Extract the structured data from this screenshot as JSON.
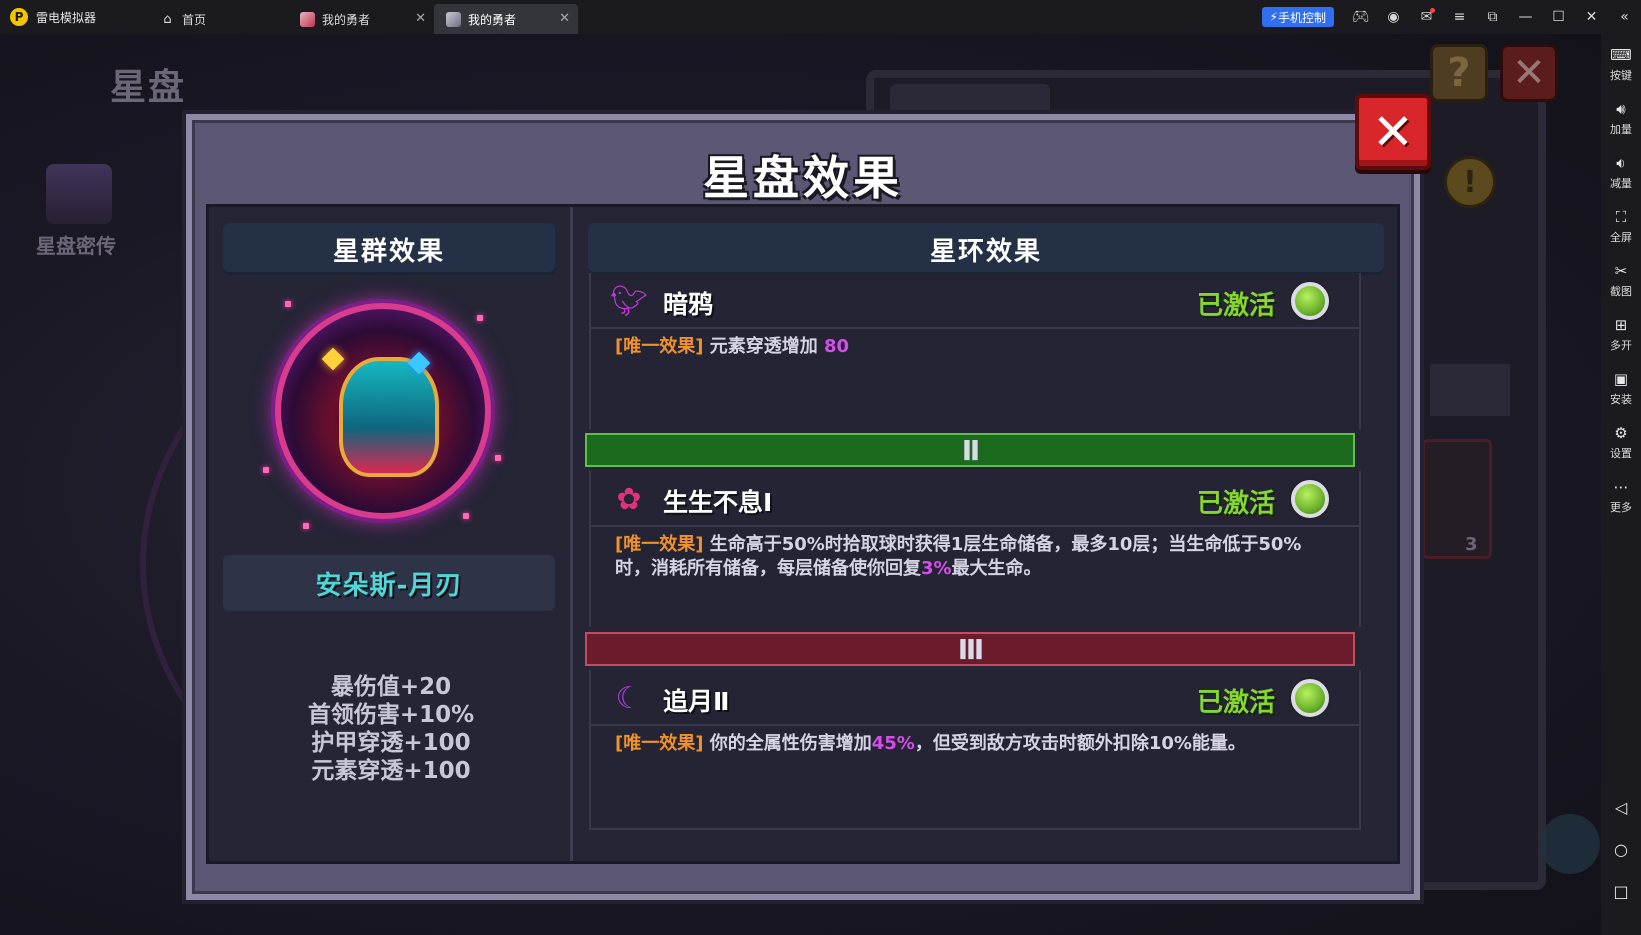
{
  "titlebar": {
    "app_name": "雷电模拟器",
    "tabs": [
      {
        "label": "首页"
      },
      {
        "label": "我的勇者"
      },
      {
        "label": "我的勇者"
      }
    ],
    "phone_control": "手机控制"
  },
  "sidebar": {
    "items": [
      {
        "label": "按键",
        "icon": "keyboard-icon"
      },
      {
        "label": "加量",
        "icon": "volume-up-icon"
      },
      {
        "label": "减量",
        "icon": "volume-down-icon"
      },
      {
        "label": "全屏",
        "icon": "fullscreen-icon"
      },
      {
        "label": "截图",
        "icon": "scissors-icon"
      },
      {
        "label": "多开",
        "icon": "multi-instance-icon"
      },
      {
        "label": "安装",
        "icon": "apk-install-icon"
      },
      {
        "label": "设置",
        "icon": "settings-icon"
      },
      {
        "label": "更多",
        "icon": "more-icon"
      }
    ]
  },
  "background": {
    "title": "星盘",
    "chest_label": "星盘密传",
    "slot_count": "3"
  },
  "dialog": {
    "title": "星盘效果",
    "left": {
      "header": "星群效果",
      "hero_name": "安朵斯-月刃",
      "stats": [
        "暴伤值+20",
        "首领伤害+10%",
        "护甲穿透+100",
        "元素穿透+100"
      ]
    },
    "right": {
      "header": "星环效果",
      "tiers": [
        {
          "label": "Ⅱ",
          "color": "#1c6a1e"
        },
        {
          "label": "Ⅲ",
          "color": "#6a1b2c"
        }
      ],
      "sections": [
        {
          "name": "暗鸦",
          "icon": "crow-icon",
          "status": "已激活",
          "tag": "[唯一效果]",
          "text_parts": [
            " 元素穿透增加 ",
            "80",
            "",
            "",
            ""
          ]
        },
        {
          "name": "生生不息Ⅰ",
          "icon": "flower-icon",
          "status": "已激活",
          "tag": "[唯一效果]",
          "text_parts": [
            " 生命高于50%时拾取球时获得1层生命储备，最多10层；当生命低于50%时，消耗所有储备，每层储备使你回复",
            "3%",
            "最大生命。",
            "",
            ""
          ]
        },
        {
          "name": "追月Ⅱ",
          "icon": "crescent-moon-icon",
          "status": "已激活",
          "tag": "[唯一效果]",
          "text_parts": [
            " 你的全属性伤害增加",
            "45%",
            "，但受到敌方攻击时额外扣除10%能量。",
            "",
            ""
          ]
        }
      ]
    }
  },
  "colors": {
    "active_green": "#86d531",
    "tag_orange": "#f0912a",
    "highlight_purple": "#d24fe8",
    "hero_name_cyan": "#4fd6d6",
    "close_red": "#d8262a"
  }
}
